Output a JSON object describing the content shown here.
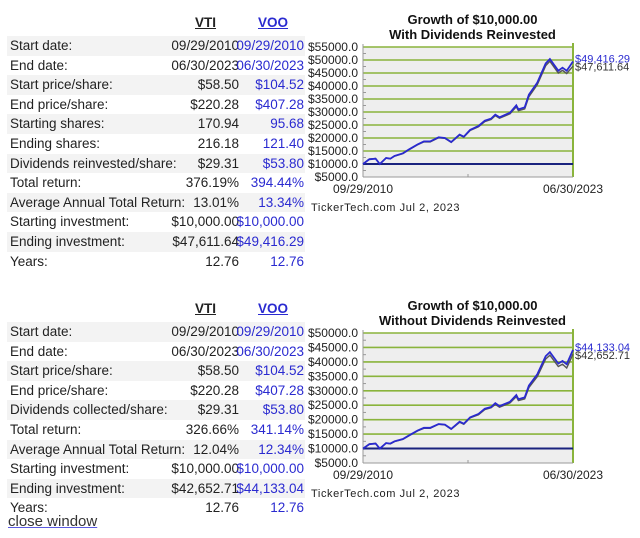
{
  "tables": [
    {
      "headers": {
        "vti": "VTI",
        "voo": "VOO"
      },
      "rows": [
        {
          "label": "Start date:",
          "vti": "09/29/2010",
          "voo": "09/29/2010"
        },
        {
          "label": "End date:",
          "vti": "06/30/2023",
          "voo": "06/30/2023"
        },
        {
          "label": "Start price/share:",
          "vti": "$58.50",
          "voo": "$104.52"
        },
        {
          "label": "End price/share:",
          "vti": "$220.28",
          "voo": "$407.28"
        },
        {
          "label": "Starting shares:",
          "vti": "170.94",
          "voo": "95.68"
        },
        {
          "label": "Ending shares:",
          "vti": "216.18",
          "voo": "121.40"
        },
        {
          "label": "Dividends reinvested/share:",
          "vti": "$29.31",
          "voo": "$53.80"
        },
        {
          "label": "Total return:",
          "vti": "376.19%",
          "voo": "394.44%"
        },
        {
          "label": "Average Annual Total Return:",
          "vti": "13.01%",
          "voo": "13.34%"
        },
        {
          "label": "Starting investment:",
          "vti": "$10,000.00",
          "voo": "$10,000.00"
        },
        {
          "label": "Ending investment:",
          "vti": "$47,611.64",
          "voo": "$49,416.29"
        },
        {
          "label": "Years:",
          "vti": "12.76",
          "voo": "12.76"
        }
      ]
    },
    {
      "headers": {
        "vti": "VTI",
        "voo": "VOO"
      },
      "rows": [
        {
          "label": "Start date:",
          "vti": "09/29/2010",
          "voo": "09/29/2010"
        },
        {
          "label": "End date:",
          "vti": "06/30/2023",
          "voo": "06/30/2023"
        },
        {
          "label": "Start price/share:",
          "vti": "$58.50",
          "voo": "$104.52"
        },
        {
          "label": "End price/share:",
          "vti": "$220.28",
          "voo": "$407.28"
        },
        {
          "label": "Dividends collected/share:",
          "vti": "$29.31",
          "voo": "$53.80"
        },
        {
          "label": "Total return:",
          "vti": "326.66%",
          "voo": "341.14%"
        },
        {
          "label": "Average Annual Total Return:",
          "vti": "12.04%",
          "voo": "12.34%"
        },
        {
          "label": "Starting investment:",
          "vti": "$10,000.00",
          "voo": "$10,000.00"
        },
        {
          "label": "Ending investment:",
          "vti": "$42,652.71",
          "voo": "$44,133.04"
        },
        {
          "label": "Years:",
          "vti": "12.76",
          "voo": "12.76"
        }
      ]
    }
  ],
  "close_link": "close window",
  "colors": {
    "voo": "#2a2ad0",
    "vti": "#555555",
    "grid": "#8ab43c",
    "baseline": "#1a237e",
    "plot_bg": "#eeeeee"
  },
  "chart_data": [
    {
      "type": "line",
      "title": "Growth of $10,000.00",
      "subtitle": "With Dividends Reinvested",
      "x_start_label": "09/29/2010",
      "x_end_label": "06/30/2023",
      "ylim": [
        5000,
        55000
      ],
      "yticks": [
        55000,
        50000,
        45000,
        40000,
        35000,
        30000,
        25000,
        20000,
        15000,
        10000,
        5000
      ],
      "ytick_labels": [
        "$55000.0",
        "$50000.0",
        "$45000.0",
        "$40000.0",
        "$35000.0",
        "$30000.0",
        "$25000.0",
        "$20000.0",
        "$15000.0",
        "$10000.0",
        "$5000.0"
      ],
      "baseline": 10000,
      "grid": true,
      "footer": "TickerTech.com  Jul 2, 2023",
      "end_labels": {
        "voo": "$49,416.29",
        "vti": "$47,611.64"
      },
      "x": [
        0,
        0.03,
        0.06,
        0.08,
        0.11,
        0.13,
        0.15,
        0.19,
        0.22,
        0.26,
        0.29,
        0.32,
        0.36,
        0.39,
        0.42,
        0.46,
        0.48,
        0.51,
        0.55,
        0.58,
        0.61,
        0.63,
        0.65,
        0.7,
        0.73,
        0.74,
        0.77,
        0.79,
        0.83,
        0.87,
        0.89,
        0.93,
        0.95,
        0.97,
        1.0
      ],
      "series": [
        {
          "name": "VOO",
          "values": [
            10000,
            11800,
            12050,
            10000,
            12300,
            12050,
            13100,
            14100,
            15650,
            17550,
            18700,
            18700,
            20250,
            20000,
            18450,
            21300,
            20500,
            23100,
            24600,
            26650,
            27450,
            29000,
            27950,
            29750,
            32550,
            31000,
            31800,
            36650,
            41300,
            48700,
            50400,
            45900,
            47050,
            45900,
            49416
          ]
        },
        {
          "name": "VTI",
          "values": [
            10000,
            11900,
            12100,
            10000,
            12300,
            12000,
            13000,
            14000,
            15500,
            17400,
            18500,
            18500,
            20100,
            19900,
            18300,
            21100,
            20300,
            22900,
            24300,
            26300,
            27100,
            28600,
            27600,
            29300,
            32000,
            30500,
            31200,
            35900,
            40500,
            47800,
            49500,
            45000,
            46000,
            44800,
            47612
          ]
        }
      ]
    },
    {
      "type": "line",
      "title": "Growth of $10,000.00",
      "subtitle": "Without Dividends Reinvested",
      "x_start_label": "09/29/2010",
      "x_end_label": "06/30/2023",
      "ylim": [
        5000,
        50000
      ],
      "yticks": [
        50000,
        45000,
        40000,
        35000,
        30000,
        25000,
        20000,
        15000,
        10000,
        5000
      ],
      "ytick_labels": [
        "$50000.0",
        "$45000.0",
        "$40000.0",
        "$35000.0",
        "$30000.0",
        "$25000.0",
        "$20000.0",
        "$15000.0",
        "$10000.0",
        "$5000.0"
      ],
      "baseline": 10000,
      "grid": true,
      "footer": "TickerTech.com  Jul 2, 2023",
      "end_labels": {
        "voo": "$44,133.04",
        "vti": "$42,652.71"
      },
      "x": [
        0,
        0.03,
        0.06,
        0.08,
        0.11,
        0.13,
        0.15,
        0.19,
        0.22,
        0.26,
        0.29,
        0.32,
        0.36,
        0.39,
        0.42,
        0.46,
        0.48,
        0.51,
        0.55,
        0.58,
        0.61,
        0.63,
        0.65,
        0.7,
        0.73,
        0.74,
        0.77,
        0.79,
        0.83,
        0.87,
        0.89,
        0.93,
        0.95,
        0.97,
        1.0
      ],
      "series": [
        {
          "name": "VOO",
          "values": [
            10000,
            11500,
            11700,
            10000,
            11900,
            11700,
            12500,
            13300,
            14600,
            16200,
            17200,
            17200,
            18500,
            18300,
            16800,
            19300,
            18600,
            20800,
            22000,
            23800,
            24400,
            25700,
            24700,
            26200,
            28500,
            27100,
            27700,
            31800,
            35700,
            42000,
            43400,
            39400,
            40300,
            39200,
            44133
          ]
        },
        {
          "name": "VTI",
          "values": [
            10000,
            11600,
            11800,
            10000,
            11900,
            11600,
            12400,
            13200,
            14500,
            16100,
            17000,
            17000,
            18400,
            18200,
            16700,
            19100,
            18400,
            20600,
            21700,
            23500,
            24100,
            25300,
            24300,
            25800,
            28000,
            26600,
            27200,
            31100,
            34900,
            41000,
            42300,
            38400,
            39200,
            37900,
            42653
          ]
        }
      ]
    }
  ]
}
